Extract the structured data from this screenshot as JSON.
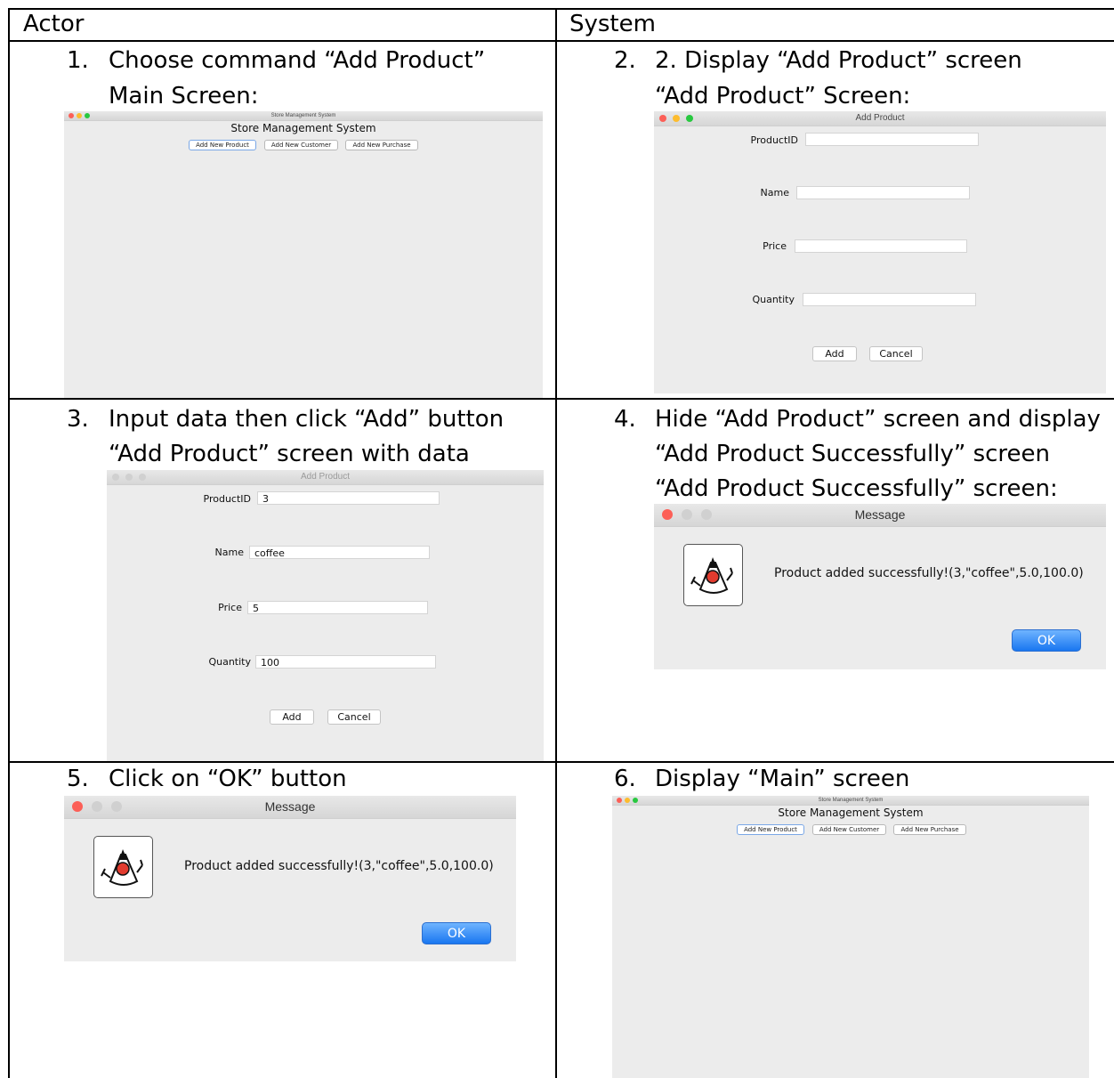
{
  "table": {
    "headers": [
      "Actor",
      "System"
    ],
    "steps": [
      {
        "num": "1.",
        "lines": [
          "Choose command “Add Product”",
          "Main Screen:"
        ]
      },
      {
        "num": "2.",
        "lines": [
          "2. Display “Add Product” screen",
          "“Add Product” Screen:"
        ]
      },
      {
        "num": "3.",
        "lines": [
          "Input data then click “Add” button",
          "“Add Product” screen with data"
        ]
      },
      {
        "num": "4.",
        "lines": [
          "Hide “Add Product” screen and display",
          "“Add Product Successfully” screen",
          "“Add Product Successfully” screen:"
        ]
      },
      {
        "num": "5.",
        "lines": [
          "Click on “OK” button"
        ]
      },
      {
        "num": "6.",
        "lines": [
          "Display “Main” screen"
        ]
      }
    ]
  },
  "main_screen": {
    "window_title": "Store Management System",
    "heading": "Store Management System",
    "buttons": [
      "Add New Product",
      "Add New Customer",
      "Add New Purchase"
    ]
  },
  "add_product_form": {
    "window_title": "Add Product",
    "labels": [
      "ProductID",
      "Name",
      "Price",
      "Quantity"
    ],
    "add_label": "Add",
    "cancel_label": "Cancel"
  },
  "add_product_filled": {
    "values": [
      "3",
      "coffee",
      "5",
      "100"
    ]
  },
  "message_dialog": {
    "window_title": "Message",
    "text": "Product added successfully!(3,\"coffee\",5.0,100.0)",
    "ok_label": "OK"
  },
  "colors": {
    "close": "#fc5f57",
    "minimize": "#fdbc2e",
    "zoom": "#28c840",
    "inactive_dot": "#d0d0d0",
    "window_bg": "#ececec",
    "ok_button": "#1976f0"
  }
}
